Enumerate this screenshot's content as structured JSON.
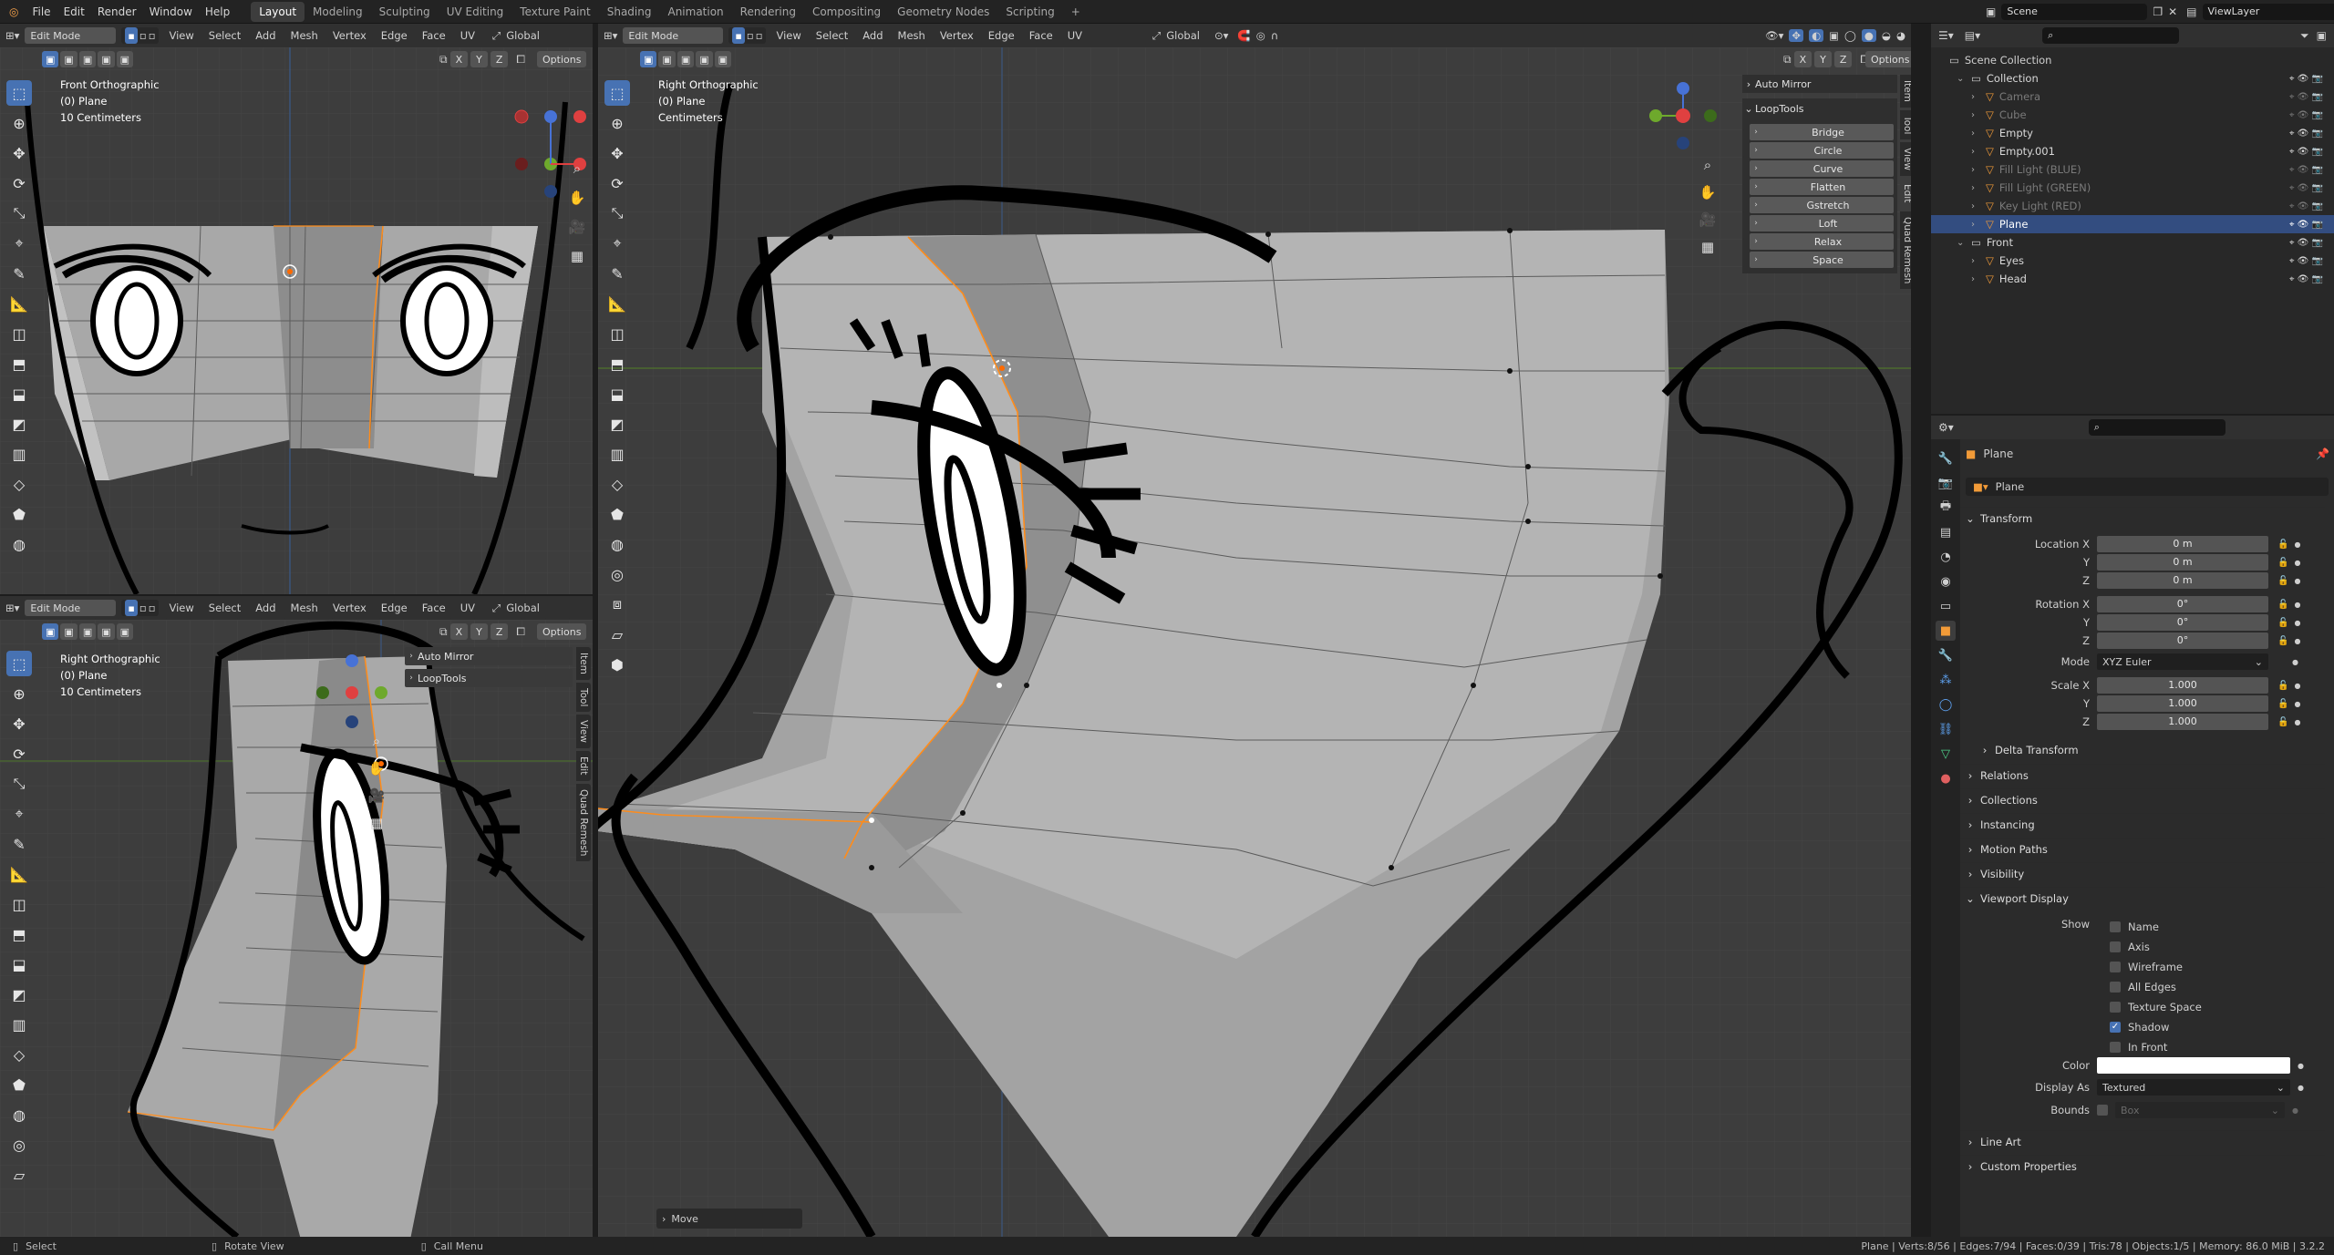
{
  "menubar": {
    "menus": [
      "File",
      "Edit",
      "Render",
      "Window",
      "Help"
    ],
    "workspaces": [
      "Layout",
      "Modeling",
      "Sculpting",
      "UV Editing",
      "Texture Paint",
      "Shading",
      "Animation",
      "Rendering",
      "Compositing",
      "Geometry Nodes",
      "Scripting"
    ],
    "active_workspace": "Layout",
    "add_tab": "+",
    "scene_name": "Scene",
    "view_layer": "ViewLayer"
  },
  "viewport_header": {
    "mode": "Edit Mode",
    "menus": [
      "View",
      "Select",
      "Add",
      "Mesh",
      "Vertex",
      "Edge",
      "Face",
      "UV"
    ],
    "orientation": "Global",
    "axes": [
      "X",
      "Y",
      "Z"
    ],
    "options": "Options"
  },
  "viewports": {
    "front": {
      "title": "Front Orthographic",
      "object": "(0) Plane",
      "scale": "10 Centimeters"
    },
    "right_small": {
      "title": "Right Orthographic",
      "object": "(0) Plane",
      "scale": "10 Centimeters"
    },
    "right_large": {
      "title": "Right Orthographic",
      "object": "(0) Plane",
      "scale": "Centimeters"
    }
  },
  "sidebar_tabs": [
    "Item",
    "Tool",
    "View",
    "Edit",
    "Quad Remesh"
  ],
  "n_panel": {
    "auto_mirror": "Auto Mirror",
    "looptools": "LoopTools",
    "buttons": [
      "Bridge",
      "Circle",
      "Curve",
      "Flatten",
      "Gstretch",
      "Loft",
      "Relax",
      "Space"
    ]
  },
  "last_operator": "Move",
  "outliner": {
    "root": "Scene Collection",
    "items": [
      {
        "name": "Collection",
        "level": 1,
        "state": "normal"
      },
      {
        "name": "Camera",
        "level": 2,
        "state": "dim"
      },
      {
        "name": "Cube",
        "level": 2,
        "state": "dim"
      },
      {
        "name": "Empty",
        "level": 2,
        "state": "normal"
      },
      {
        "name": "Empty.001",
        "level": 2,
        "state": "normal"
      },
      {
        "name": "Fill Light (BLUE)",
        "level": 2,
        "state": "dim"
      },
      {
        "name": "Fill Light (GREEN)",
        "level": 2,
        "state": "dim"
      },
      {
        "name": "Key Light (RED)",
        "level": 2,
        "state": "dim"
      },
      {
        "name": "Plane",
        "level": 2,
        "state": "selected"
      },
      {
        "name": "Front",
        "level": 1,
        "state": "normal"
      },
      {
        "name": "Eyes",
        "level": 2,
        "state": "normal"
      },
      {
        "name": "Head",
        "level": 2,
        "state": "normal"
      }
    ]
  },
  "properties": {
    "object_name": "Plane",
    "object_field": "Plane",
    "transform_label": "Transform",
    "location": {
      "label": "Location X",
      "x": "0 m",
      "y": "0 m",
      "z": "0 m"
    },
    "rotation": {
      "label": "Rotation X",
      "x": "0°",
      "y": "0°",
      "z": "0°"
    },
    "axis_labels": {
      "y": "Y",
      "z": "Z"
    },
    "mode_label": "Mode",
    "mode_value": "XYZ Euler",
    "scale": {
      "label": "Scale X",
      "x": "1.000",
      "y": "1.000",
      "z": "1.000"
    },
    "delta_transform": "Delta Transform",
    "panels": [
      "Relations",
      "Collections",
      "Instancing",
      "Motion Paths",
      "Visibility"
    ],
    "viewport_display": "Viewport Display",
    "show_label": "Show",
    "show_options": [
      {
        "label": "Name",
        "checked": false
      },
      {
        "label": "Axis",
        "checked": false
      },
      {
        "label": "Wireframe",
        "checked": false
      },
      {
        "label": "All Edges",
        "checked": false
      },
      {
        "label": "Texture Space",
        "checked": false
      },
      {
        "label": "Shadow",
        "checked": true
      },
      {
        "label": "In Front",
        "checked": false
      }
    ],
    "color_label": "Color",
    "color_value": "#ffffff",
    "display_as_label": "Display As",
    "display_as_value": "Textured",
    "bounds_label": "Bounds",
    "bounds_value": "Box",
    "bottom_panels": [
      "Line Art",
      "Custom Properties"
    ]
  },
  "statusbar": {
    "select": "Select",
    "rotate": "Rotate View",
    "menu": "Call Menu",
    "stats": "Plane | Verts:8/56 | Edges:7/94 | Faces:0/39 | Tris:78 | Objects:1/5 | Memory: 86.0 MiB | 3.2.2"
  },
  "colors": {
    "accent": "#4772b3",
    "selection_edge": "#ff8c1a",
    "mesh": "#a9a9a9",
    "background": "#3d3d3d"
  }
}
